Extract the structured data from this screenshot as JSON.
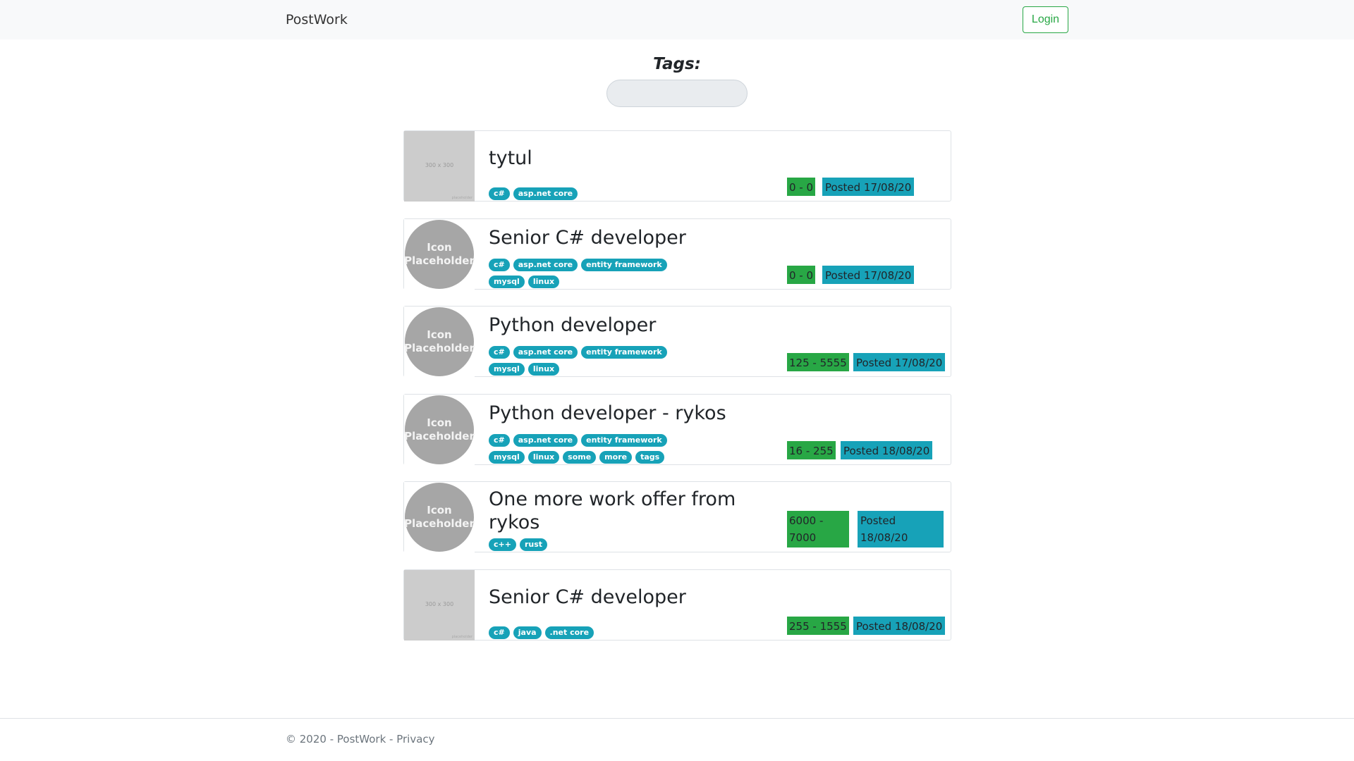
{
  "header": {
    "brand": "PostWork",
    "login_label": "Login"
  },
  "filter": {
    "title": "Tags:",
    "input_value": ""
  },
  "offers": [
    {
      "title": "tytul",
      "image": "300 x 300",
      "tags": [
        "c#",
        "asp.net core"
      ],
      "salary": "0 - 0",
      "posted": "Posted 17/08/20"
    },
    {
      "title": "Senior C# developer",
      "image": "Icon Placeholder",
      "tags": [
        "c#",
        "asp.net core",
        "entity framework",
        "mysql",
        "linux"
      ],
      "salary": "0 - 0",
      "posted": "Posted 17/08/20"
    },
    {
      "title": "Python developer",
      "image": "Icon Placeholder",
      "tags": [
        "c#",
        "asp.net core",
        "entity framework",
        "mysql",
        "linux"
      ],
      "salary": "125 - 5555",
      "posted": "Posted 17/08/20"
    },
    {
      "title": "Python developer - rykos",
      "image": "Icon Placeholder",
      "tags": [
        "c#",
        "asp.net core",
        "entity framework",
        "mysql",
        "linux",
        "some",
        "more",
        "tags"
      ],
      "salary": "16 - 255",
      "posted": "Posted 18/08/20"
    },
    {
      "title": "One more work offer from rykos",
      "image": "Icon Placeholder",
      "tags": [
        "c++",
        "rust"
      ],
      "salary": "6000 - 7000",
      "posted": "Posted 18/08/20"
    },
    {
      "title": "Senior C# developer",
      "image": "300 x 300",
      "tags": [
        "c#",
        "java",
        ".net core"
      ],
      "salary": "255 - 1555",
      "posted": "Posted 18/08/20"
    }
  ],
  "footer": {
    "copyright": "© 2020 - PostWork - ",
    "privacy_label": "Privacy"
  },
  "colors": {
    "salary": "#28a745",
    "posted": "#17a2b8",
    "tag": "#17a2b8",
    "login": "#28a745"
  }
}
